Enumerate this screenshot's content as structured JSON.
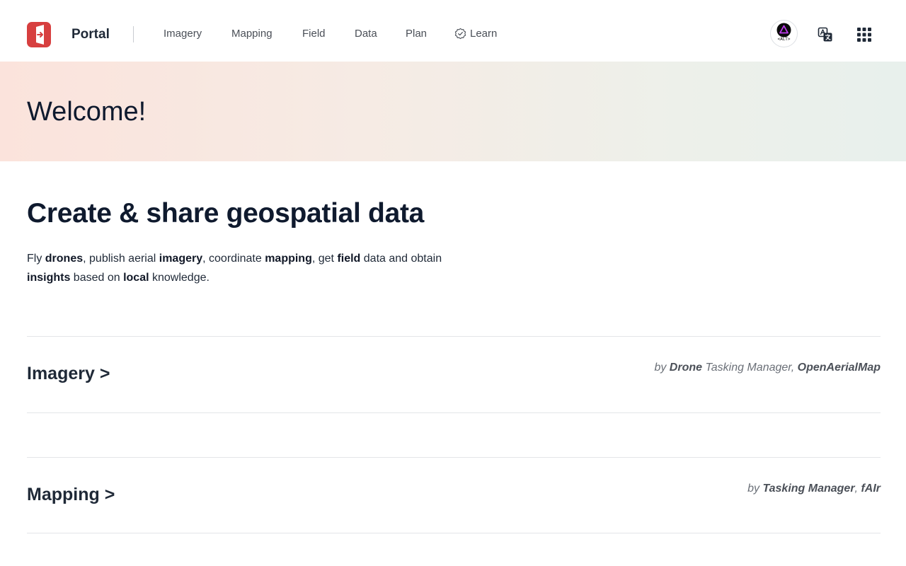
{
  "header": {
    "brand": "Portal",
    "nav": [
      {
        "label": "Imagery"
      },
      {
        "label": "Mapping"
      },
      {
        "label": "Field"
      },
      {
        "label": "Data"
      },
      {
        "label": "Plan"
      },
      {
        "label": "Learn",
        "icon": "verified-badge-icon"
      }
    ],
    "avatar_caption": "<ALT>",
    "icons": [
      "translate-icon",
      "apps-grid-icon"
    ],
    "accent_color": "#d73f3f"
  },
  "banner": {
    "title": "Welcome!"
  },
  "main": {
    "title": "Create & share geospatial data",
    "intro": {
      "t1": "Fly ",
      "b1": "drones",
      "t2": ", publish aerial ",
      "b2": "imagery",
      "t3": ", coordinate ",
      "b3": "mapping",
      "t4": ", get ",
      "b4": "field",
      "t5": " data and obtain ",
      "b5": "insights",
      "t6": " based on ",
      "b6": "local",
      "t7": " knowledge."
    },
    "sections": [
      {
        "title": "Imagery >",
        "by_prefix": "by ",
        "by_bold1": "Drone",
        "by_mid": " Tasking Manager, ",
        "by_bold2": "OpenAerialMap"
      },
      {
        "title": "Mapping >",
        "by_prefix": "by ",
        "by_bold1": "Tasking Manager",
        "by_mid": ", ",
        "by_bold2": "fAIr"
      }
    ]
  }
}
